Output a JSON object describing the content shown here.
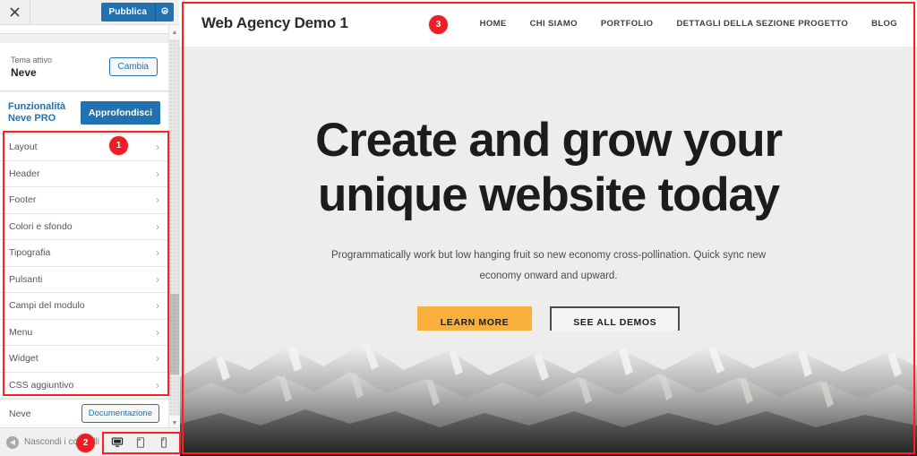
{
  "customizer": {
    "close_icon": "close-x-icon",
    "publish_label": "Pubblica",
    "gear_icon": "gear-icon",
    "theme": {
      "label": "Tema attivo",
      "name": "Neve",
      "change_label": "Cambia"
    },
    "pro": {
      "title": "Funzionalità Neve PRO",
      "button_label": "Approfondisci"
    },
    "menu_items": [
      {
        "label": "Layout",
        "chevron": "chevron-right-icon"
      },
      {
        "label": "Header",
        "chevron": "chevron-right-icon"
      },
      {
        "label": "Footer",
        "chevron": "chevron-right-icon"
      },
      {
        "label": "Colori e sfondo",
        "chevron": "chevron-right-icon"
      },
      {
        "label": "Tipografia",
        "chevron": "chevron-right-icon"
      },
      {
        "label": "Pulsanti",
        "chevron": "chevron-right-icon"
      },
      {
        "label": "Campi del modulo",
        "chevron": "chevron-right-icon"
      },
      {
        "label": "Menu",
        "chevron": "chevron-right-icon"
      },
      {
        "label": "Widget",
        "chevron": "chevron-right-icon"
      },
      {
        "label": "CSS aggiuntivo",
        "chevron": "chevron-right-icon"
      }
    ],
    "footer_theme": {
      "name": "Neve",
      "doc_label": "Documentazione"
    },
    "bottom_bar": {
      "collapse_label": "Nascondi i controlli",
      "collapse_icon": "arrow-left-circle-icon",
      "devices": [
        {
          "name": "desktop",
          "icon": "desktop-icon",
          "active": true
        },
        {
          "name": "tablet",
          "icon": "tablet-icon",
          "active": false
        },
        {
          "name": "mobile",
          "icon": "mobile-icon",
          "active": false
        }
      ]
    }
  },
  "preview": {
    "site_title": "Web Agency Demo 1",
    "nav": [
      "HOME",
      "CHI SIAMO",
      "PORTFOLIO",
      "DETTAGLI DELLA SEZIONE PROGETTO",
      "BLOG"
    ],
    "hero": {
      "heading": "Create and grow your unique website today",
      "subheading": "Programmatically work but low hanging fruit so new economy cross-pollination. Quick sync new economy onward and upward.",
      "primary_button": "LEARN MORE",
      "secondary_button": "SEE ALL DEMOS",
      "background_color": "#edeeec",
      "primary_button_color": "#f8af3c",
      "image_alt": "grayscale-mountain-range-photo"
    }
  },
  "annotations": {
    "accent_color": "#ee1c25",
    "badges": [
      {
        "number": "1",
        "target": "customizer-menu-list"
      },
      {
        "number": "2",
        "target": "device-preview-controls"
      },
      {
        "number": "3",
        "target": "site-preview-pane"
      }
    ]
  }
}
